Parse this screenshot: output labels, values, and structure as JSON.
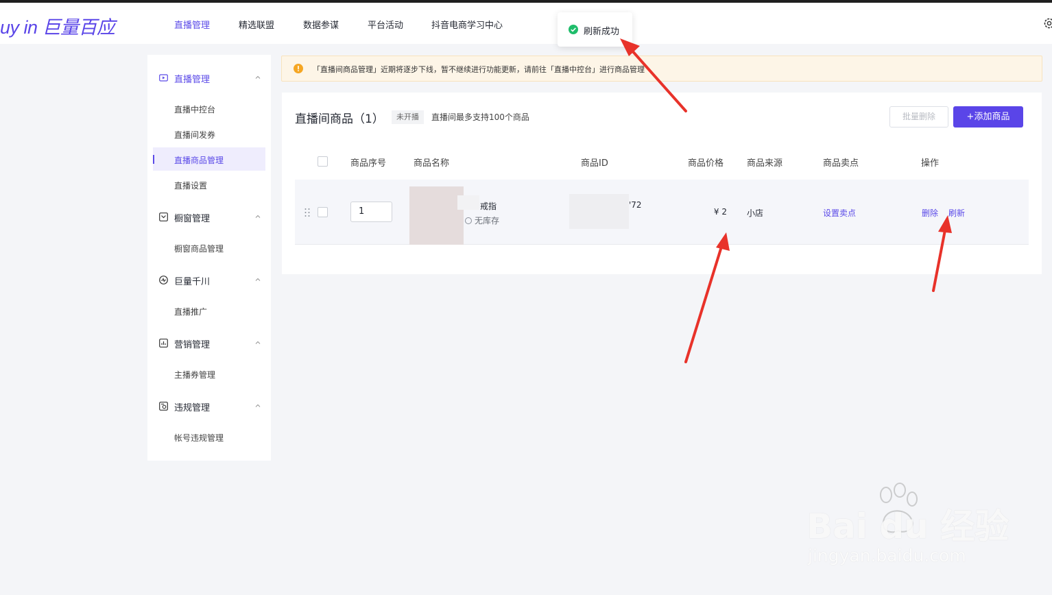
{
  "app": {
    "logo_text": "uy in 巨量百应",
    "nav": [
      "直播管理",
      "精选联盟",
      "数据参谋",
      "平台活动",
      "抖音电商学习中心"
    ]
  },
  "toast": {
    "text": "刷新成功"
  },
  "sidebar": {
    "groups": [
      {
        "label": "直播管理",
        "items": [
          "直播中控台",
          "直播间发券",
          "直播商品管理",
          "直播设置"
        ]
      },
      {
        "label": "橱窗管理",
        "items": [
          "橱窗商品管理"
        ]
      },
      {
        "label": "巨量千川",
        "items": [
          "直播推广"
        ]
      },
      {
        "label": "营销管理",
        "items": [
          "主播券管理"
        ]
      },
      {
        "label": "违规管理",
        "items": [
          "帐号违规管理"
        ]
      }
    ]
  },
  "notice": {
    "text": "「直播间商品管理」近期将逐步下线，暂不继续进行功能更新，请前往「直播中控台」进行商品管理"
  },
  "card": {
    "title": "直播间商品（1）",
    "status_badge": "未开播",
    "hint": "直播间最多支持100个商品",
    "batch_delete": "批量删除",
    "add_product": "+添加商品"
  },
  "table": {
    "headers": [
      "商品序号",
      "商品名称",
      "商品ID",
      "商品价格",
      "商品来源",
      "商品卖点",
      "操作"
    ],
    "rows": [
      {
        "seq": "1",
        "name": "戒指",
        "stock": "无库存",
        "id": "'72",
        "price": "¥ 2",
        "source": "小店",
        "selling_point": "设置卖点",
        "delete": "删除",
        "refresh": "刷新"
      }
    ]
  },
  "watermark": {
    "logo": "Bai du 经验",
    "url": "jingyan.baidu.com"
  },
  "colors": {
    "accent": "#5a45e8",
    "warning": "#f5a623",
    "success": "#1fbd6b",
    "annotation_arrow": "#e8322a"
  }
}
